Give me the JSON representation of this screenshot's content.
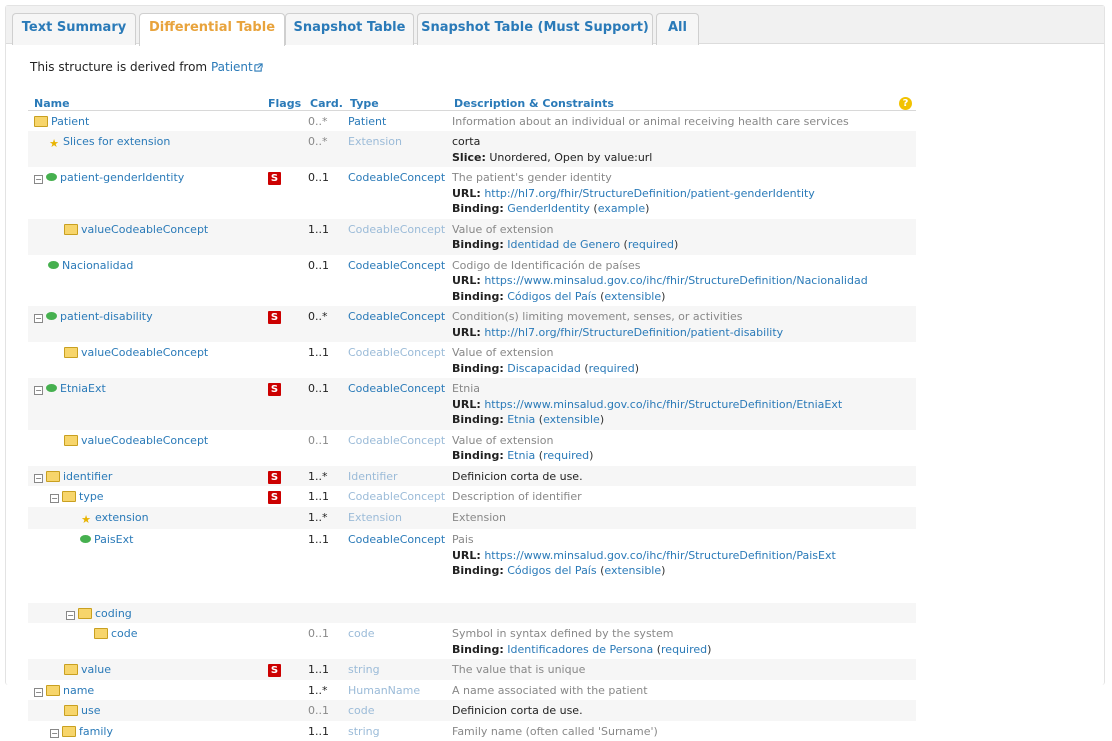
{
  "tabs": [
    {
      "label": "Text Summary"
    },
    {
      "label": "Differential Table"
    },
    {
      "label": "Snapshot Table"
    },
    {
      "label": "Snapshot Table (Must Support)"
    },
    {
      "label": "All"
    }
  ],
  "derived": {
    "prefix": "This structure is derived from ",
    "link": "Patient"
  },
  "columns": {
    "name": "Name",
    "flags": "Flags",
    "card": "Card.",
    "type": "Type",
    "desc": "Description & Constraints"
  },
  "rows": [
    {
      "name": "Patient",
      "flag": "",
      "card": "0..*",
      "type": "Patient",
      "desc": "Information about an individual or animal receiving health care services"
    },
    {
      "name": "Slices for extension",
      "flag": "",
      "card": "0..*",
      "type": "Extension",
      "desc": "corta",
      "slice_label": "Slice:",
      "slice": "Unordered, Open by value:url"
    },
    {
      "name": "patient-genderIdentity",
      "flag": "S",
      "card": "0..1",
      "type": "CodeableConcept",
      "desc": "The patient's gender identity",
      "url_label": "URL:",
      "url": "http://hl7.org/fhir/StructureDefinition/patient-genderIdentity",
      "binding_label": "Binding:",
      "binding": "GenderIdentity",
      "strength": "example"
    },
    {
      "name": "valueCodeableConcept",
      "flag": "",
      "card": "1..1",
      "type": "CodeableConcept",
      "desc": "Value of extension",
      "binding_label": "Binding:",
      "binding": "Identidad de Genero",
      "strength": "required"
    },
    {
      "name": "Nacionalidad",
      "flag": "",
      "card": "0..1",
      "type": "CodeableConcept",
      "desc": "Codigo de Identificación de países",
      "url_label": "URL:",
      "url": "https://www.minsalud.gov.co/ihc/fhir/StructureDefinition/Nacionalidad",
      "binding_label": "Binding:",
      "binding": "Códigos del País",
      "strength": "extensible"
    },
    {
      "name": "patient-disability",
      "flag": "S",
      "card": "0..*",
      "type": "CodeableConcept",
      "desc": "Condition(s) limiting movement, senses, or activities",
      "url_label": "URL:",
      "url": "http://hl7.org/fhir/StructureDefinition/patient-disability"
    },
    {
      "name": "valueCodeableConcept",
      "flag": "",
      "card": "1..1",
      "type": "CodeableConcept",
      "desc": "Value of extension",
      "binding_label": "Binding:",
      "binding": "Discapacidad",
      "strength": "required"
    },
    {
      "name": "EtniaExt",
      "flag": "S",
      "card": "0..1",
      "type": "CodeableConcept",
      "desc": "Etnia",
      "url_label": "URL:",
      "url": "https://www.minsalud.gov.co/ihc/fhir/StructureDefinition/EtniaExt",
      "binding_label": "Binding:",
      "binding": "Etnia",
      "strength": "extensible"
    },
    {
      "name": "valueCodeableConcept",
      "flag": "",
      "card": "0..1",
      "type": "CodeableConcept",
      "desc": "Value of extension",
      "binding_label": "Binding:",
      "binding": "Etnia",
      "strength": "required"
    },
    {
      "name": "identifier",
      "flag": "S",
      "card": "1..*",
      "type": "Identifier",
      "desc": "Definicion corta de use."
    },
    {
      "name": "type",
      "flag": "S",
      "card": "1..1",
      "type": "CodeableConcept",
      "desc": "Description of identifier"
    },
    {
      "name": "extension",
      "flag": "",
      "card": "1..*",
      "type": "Extension",
      "desc": "Extension"
    },
    {
      "name": "PaisExt",
      "flag": "",
      "card": "1..1",
      "type": "CodeableConcept",
      "desc": "Pais",
      "url_label": "URL:",
      "url": "https://www.minsalud.gov.co/ihc/fhir/StructureDefinition/PaisExt",
      "binding_label": "Binding:",
      "binding": "Códigos del País",
      "strength": "extensible"
    },
    {
      "name": "coding",
      "flag": "",
      "card": "",
      "type": "",
      "desc": ""
    },
    {
      "name": "code",
      "flag": "",
      "card": "0..1",
      "type": "code",
      "desc": "Symbol in syntax defined by the system",
      "binding_label": "Binding:",
      "binding": "Identificadores de Persona",
      "strength": "required"
    },
    {
      "name": "value",
      "flag": "S",
      "card": "1..1",
      "type": "string",
      "desc": "The value that is unique"
    },
    {
      "name": "name",
      "flag": "",
      "card": "1..*",
      "type": "HumanName",
      "desc": "A name associated with the patient"
    },
    {
      "name": "use",
      "flag": "",
      "card": "0..1",
      "type": "code",
      "desc": "Definicion corta de use."
    },
    {
      "name": "family",
      "flag": "",
      "card": "1..1",
      "type": "string",
      "desc": "Family name (often called 'Surname')"
    }
  ],
  "icons": {
    "help": "help-icon",
    "external": "external-link-icon",
    "folder": "folder-icon",
    "extension": "extension-dot-icon",
    "slice": "star-icon"
  },
  "colors": {
    "link": "#2a7ab8",
    "active_tab": "#e8a33c",
    "flag_s": "#cc0000",
    "alt_row": "#f6f6f6"
  }
}
